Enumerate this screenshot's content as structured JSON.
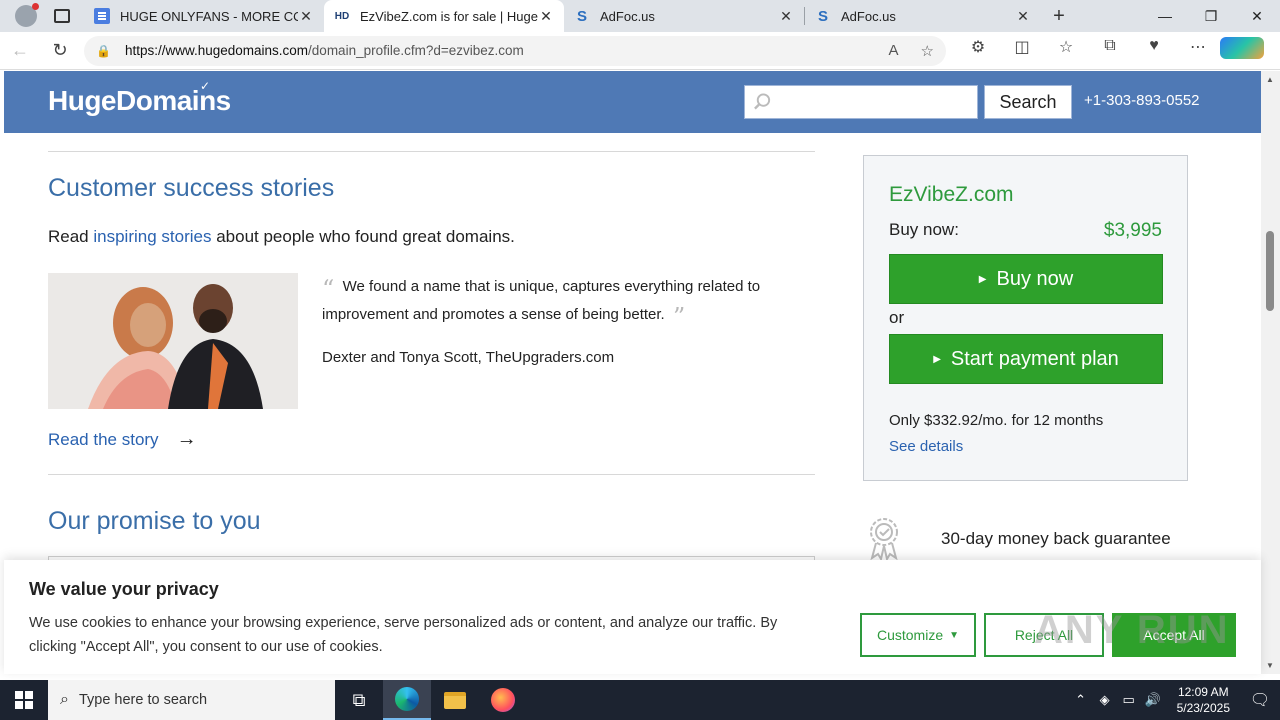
{
  "browser": {
    "tabs": [
      {
        "title": "HUGE ONLYFANS - MORE COMIN",
        "favicon": "doc-icon",
        "active": false
      },
      {
        "title": "EzVibeZ.com is for sale | HugeDo",
        "favicon": "HD",
        "active": true
      },
      {
        "title": "AdFoc.us",
        "favicon": "adfoc-icon",
        "active": false
      },
      {
        "title": "AdFoc.us",
        "favicon": "adfoc-icon",
        "active": false
      }
    ],
    "url_host": "https://www.hugedomains.com",
    "url_path": "/domain_profile.cfm?d=ezvibez.com"
  },
  "site": {
    "logo": "HugeDomains",
    "search_placeholder": "",
    "search_button": "Search",
    "phone": "+1-303-893-0552",
    "brand_color": "#4f79b5",
    "green": "#2ea12b"
  },
  "stories": {
    "title": "Customer success stories",
    "lead_before": "Read ",
    "lead_link": "inspiring stories",
    "lead_after": " about people who found great domains.",
    "quote": "We found a name that is unique, captures everything related to improvement and promotes a sense of being better.",
    "quote_open": "“",
    "quote_close": "”",
    "author": "Dexter and Tonya Scott, TheUpgraders.com",
    "read_story": "Read the story",
    "arrow": "→"
  },
  "promise": {
    "title": "Our promise to you"
  },
  "buybox": {
    "domain": "EzVibeZ.com",
    "buy_label": "Buy now:",
    "price": "$3,995",
    "buy_button": "Buy now",
    "or": "or",
    "plan_button": "Start payment plan",
    "terms": "Only $332.92/mo. for 12 months",
    "details": "See details"
  },
  "guarantee": {
    "text": "30-day money back guarantee"
  },
  "cookie": {
    "title": "We value your privacy",
    "body": "We use cookies to enhance your browsing experience, serve personalized ads or content, and analyze our traffic. By clicking \"Accept All\", you consent to our use of cookies.",
    "customize": "Customize",
    "reject": "Reject All",
    "accept": "Accept All"
  },
  "watermark": "ANY RUN",
  "taskbar": {
    "search_placeholder": "Type here to search",
    "time": "12:09 AM",
    "date": "5/23/2025"
  }
}
